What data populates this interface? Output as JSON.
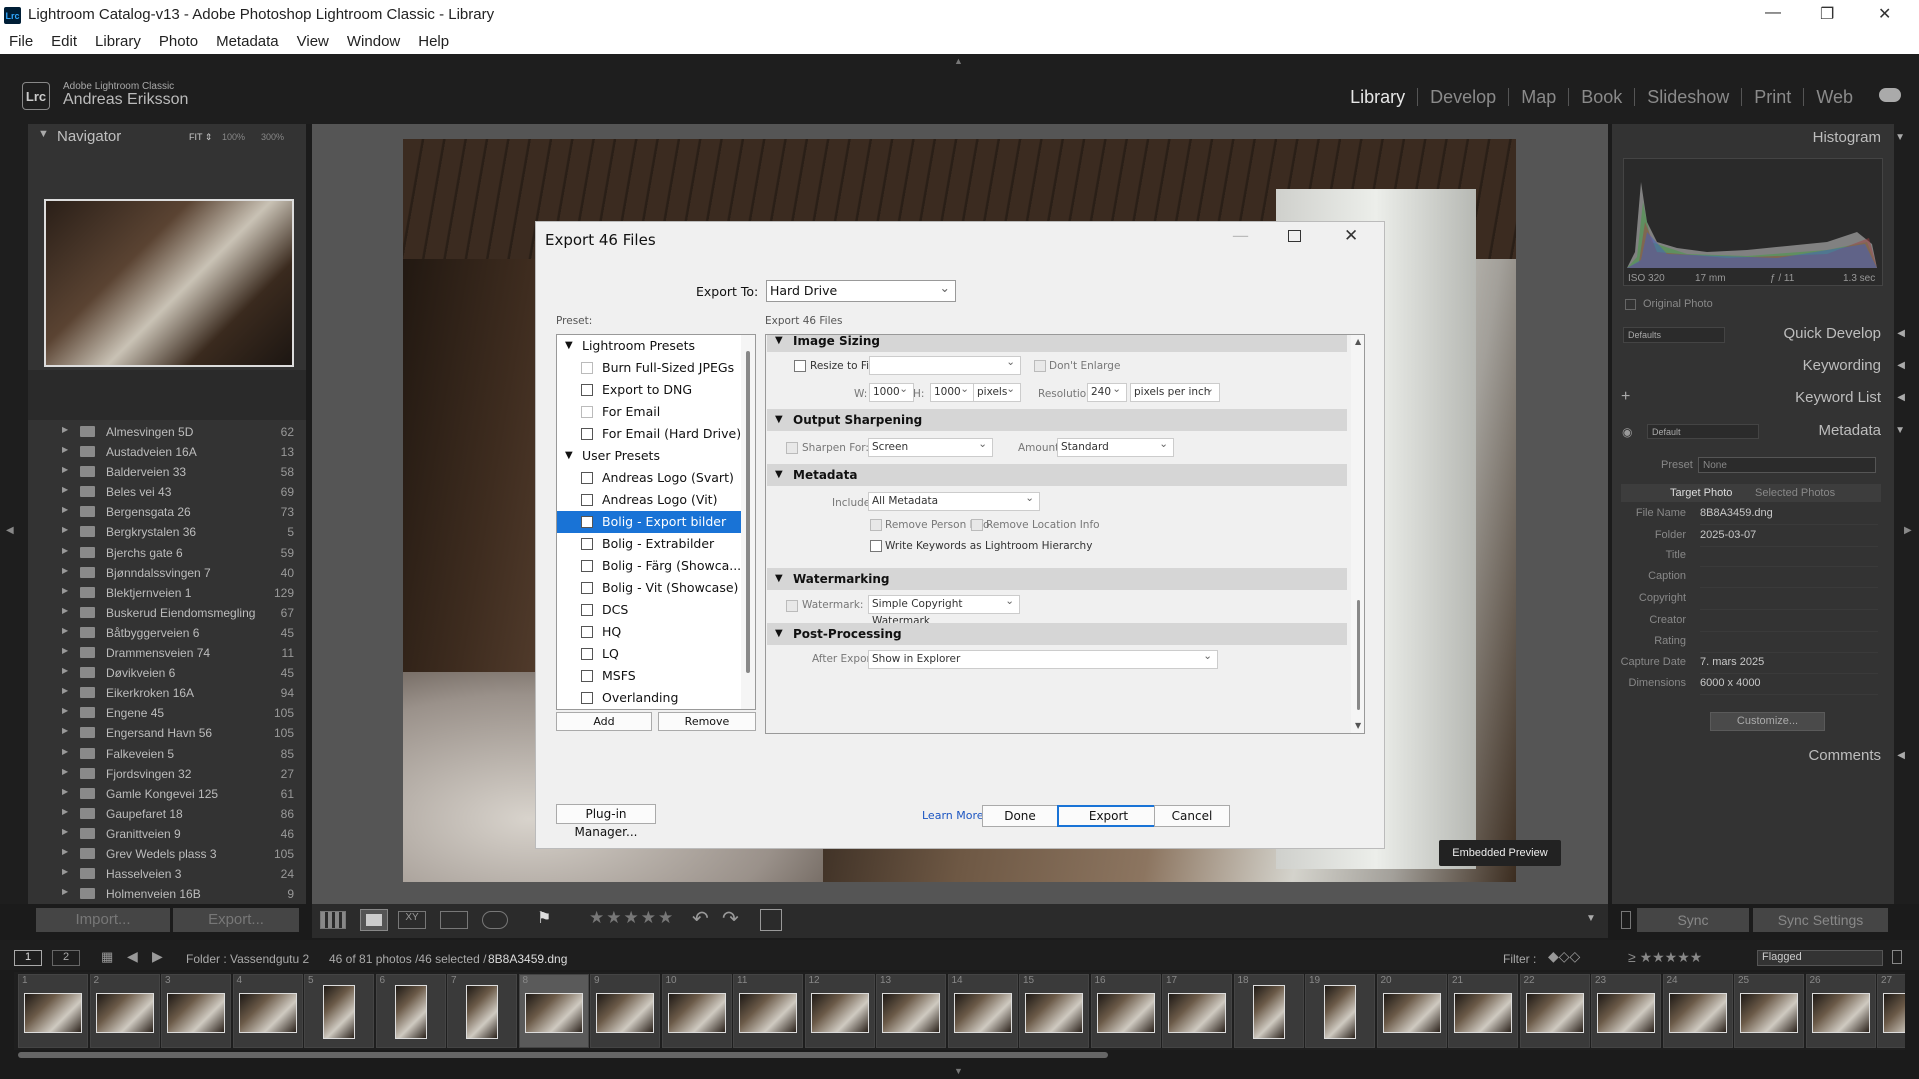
{
  "app": {
    "title": "Lightroom Catalog-v13 - Adobe Photoshop Lightroom Classic - Library",
    "icon": "Lrc",
    "product": "Adobe Lightroom Classic",
    "user": "Andreas Eriksson"
  },
  "menu": [
    "File",
    "Edit",
    "Library",
    "Photo",
    "Metadata",
    "View",
    "Window",
    "Help"
  ],
  "modules": [
    "Library",
    "Develop",
    "Map",
    "Book",
    "Slideshow",
    "Print",
    "Web"
  ],
  "navigator": {
    "title": "Navigator",
    "zoom": [
      "FIT ⇕",
      "100%",
      "300%"
    ]
  },
  "folders": [
    {
      "name": "Almesvingen 5D",
      "count": "62"
    },
    {
      "name": "Austadveien 16A",
      "count": "13"
    },
    {
      "name": "Balderveien 33",
      "count": "58"
    },
    {
      "name": "Beles vei 43",
      "count": "69"
    },
    {
      "name": "Bergensgata 26",
      "count": "73"
    },
    {
      "name": "Bergkrystalen 36",
      "count": "5"
    },
    {
      "name": "Bjerchs gate 6",
      "count": "59"
    },
    {
      "name": "Bjønndalssvingen 7",
      "count": "40"
    },
    {
      "name": "Blektjernveien 1",
      "count": "129"
    },
    {
      "name": "Buskerud Eiendomsmegling",
      "count": "67"
    },
    {
      "name": "Båtbyggerveien 6",
      "count": "45"
    },
    {
      "name": "Drammensveien 74",
      "count": "11"
    },
    {
      "name": "Døvikveien 6",
      "count": "45"
    },
    {
      "name": "Eikerkroken 16A",
      "count": "94"
    },
    {
      "name": "Engene 45",
      "count": "105"
    },
    {
      "name": "Engersand Havn 56",
      "count": "105"
    },
    {
      "name": "Falkeveien 5",
      "count": "85"
    },
    {
      "name": "Fjordsvingen 32",
      "count": "27"
    },
    {
      "name": "Gamle Kongevei 125",
      "count": "61"
    },
    {
      "name": "Gaupefaret 18",
      "count": "86"
    },
    {
      "name": "Granittveien 9",
      "count": "46"
    },
    {
      "name": "Grev Wedels plass 3",
      "count": "105"
    },
    {
      "name": "Hasselveien 3",
      "count": "24"
    },
    {
      "name": "Holmenveien 16B",
      "count": "9"
    }
  ],
  "left_buttons": {
    "import": "Import...",
    "export": "Export..."
  },
  "right": {
    "histogram": "Histogram",
    "hist_info": [
      "ISO 320",
      "17 mm",
      "ƒ / 11",
      "1.3 sec"
    ],
    "original_photo": "Original Photo",
    "defaults": "Defaults",
    "quick_develop": "Quick Develop",
    "keywording": "Keywording",
    "keyword_list": "Keyword List",
    "metadata_preset_select": "Default",
    "metadata": "Metadata",
    "preset_label": "Preset",
    "preset_value": "None",
    "tab_target": "Target Photo",
    "tab_selected": "Selected Photos",
    "fields": [
      {
        "label": "File Name",
        "value": "8B8A3459.dng"
      },
      {
        "label": "Folder",
        "value": "2025-03-07"
      },
      {
        "label": "Title",
        "value": ""
      },
      {
        "label": "Caption",
        "value": ""
      },
      {
        "label": "Copyright",
        "value": ""
      },
      {
        "label": "Creator",
        "value": ""
      },
      {
        "label": "Rating",
        "value": ""
      },
      {
        "label": "Capture Date",
        "value": "7. mars 2025"
      },
      {
        "label": "Dimensions",
        "value": "6000 x 4000"
      }
    ],
    "customize": "Customize...",
    "comments": "Comments",
    "sync": "Sync",
    "sync_settings": "Sync Settings"
  },
  "embedded_preview": "Embedded Preview",
  "filmstrip": {
    "pages": [
      "1",
      "2"
    ],
    "folder": "Folder : Vassendgutu 2",
    "count": "46 of 81 photos /46 selected /",
    "file": "8B8A3459.dng",
    "filter_label": "Filter :",
    "filter_value": "Flagged",
    "numbers": [
      "1",
      "2",
      "3",
      "4",
      "5",
      "6",
      "7",
      "8",
      "9",
      "10",
      "11",
      "12",
      "13",
      "14",
      "15",
      "16",
      "17",
      "18",
      "19",
      "20",
      "21",
      "22",
      "23",
      "24",
      "25",
      "26",
      "27"
    ]
  },
  "dialog": {
    "title": "Export 46 Files",
    "export_to_label": "Export To:",
    "export_to_value": "Hard Drive",
    "preset_label": "Preset:",
    "settings_label": "Export 46 Files",
    "presets": [
      {
        "label": "Lightroom Presets",
        "group": true
      },
      {
        "label": "Burn Full-Sized JPEGs",
        "dim": true
      },
      {
        "label": "Export to DNG"
      },
      {
        "label": "For Email",
        "dim": true
      },
      {
        "label": "For Email (Hard Drive)"
      },
      {
        "label": "User Presets",
        "group": true
      },
      {
        "label": "Andreas Logo (Svart)"
      },
      {
        "label": "Andreas Logo (Vit)"
      },
      {
        "label": "Bolig - Export bilder",
        "selected": true
      },
      {
        "label": "Bolig - Extrabilder"
      },
      {
        "label": "Bolig - Färg (Showca..."
      },
      {
        "label": "Bolig - Vit (Showcase)"
      },
      {
        "label": "DCS"
      },
      {
        "label": "HQ"
      },
      {
        "label": "LQ"
      },
      {
        "label": "MSFS"
      },
      {
        "label": "Overlanding"
      }
    ],
    "add": "Add",
    "remove": "Remove",
    "image_sizing": {
      "header": "Image Sizing",
      "resize": "Resize to Fit:",
      "dont_enlarge": "Don't Enlarge",
      "w_label": "W:",
      "w": "1000",
      "h_label": "H:",
      "h": "1000",
      "unit": "pixels",
      "res_label": "Resolution:",
      "res": "240",
      "res_unit": "pixels per inch"
    },
    "sharpening": {
      "header": "Output Sharpening",
      "for": "Sharpen For:",
      "for_value": "Screen",
      "amount": "Amount:",
      "amount_value": "Standard"
    },
    "metadata": {
      "header": "Metadata",
      "include": "Include:",
      "include_value": "All Metadata",
      "person": "Remove Person Info",
      "location": "Remove Location Info",
      "keywords": "Write Keywords as Lightroom Hierarchy"
    },
    "watermark": {
      "header": "Watermarking",
      "label": "Watermark:",
      "value": "Simple Copyright Watermark"
    },
    "post": {
      "header": "Post-Processing",
      "after": "After Export:",
      "after_value": "Show in Explorer"
    },
    "plugin": "Plug-in Manager...",
    "learn": "Learn More",
    "done": "Done",
    "export": "Export",
    "cancel": "Cancel"
  }
}
